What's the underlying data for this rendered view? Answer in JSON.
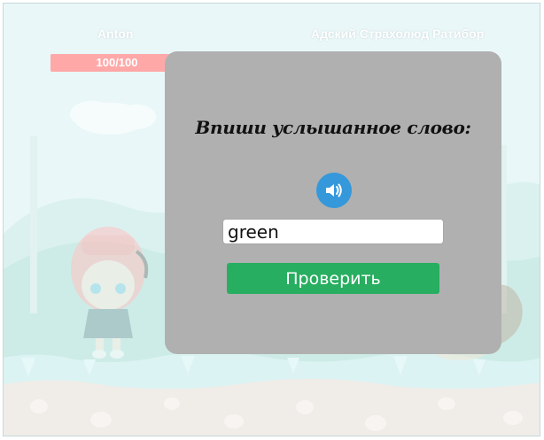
{
  "game": {
    "player": {
      "name": "Anton",
      "hp_text": "100/100",
      "hp_fraction": 1.0
    },
    "enemy": {
      "name": "Адский Страхолюд Ратибор"
    }
  },
  "modal": {
    "title": "Впиши услышанное слово:",
    "audio_icon": "speaker-volume-icon",
    "answer_value": "green",
    "check_label": "Проверить"
  },
  "colors": {
    "modal_bg": "#b0b0b0",
    "audio_button": "#3498db",
    "check_button": "#27ae60",
    "hp_bar": "#ffa8a8"
  }
}
